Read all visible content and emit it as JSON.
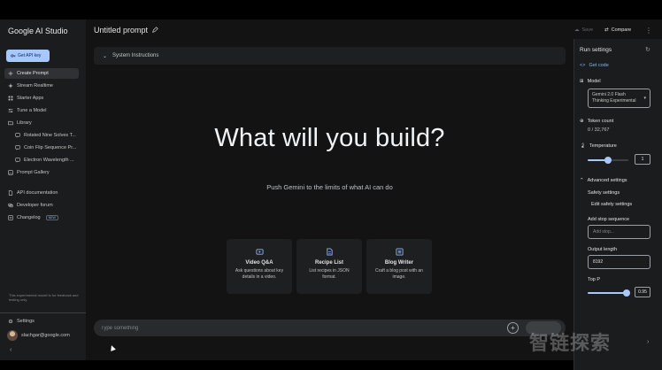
{
  "sidebar": {
    "brand": "Google AI Studio",
    "api_key_button": "Get API key",
    "items": [
      {
        "label": "Create Prompt",
        "icon": "plus-icon"
      },
      {
        "label": "Stream Realtime",
        "icon": "sparkle-icon"
      },
      {
        "label": "Starter Apps",
        "icon": "apps-icon"
      },
      {
        "label": "Tune a Model",
        "icon": "tune-icon"
      },
      {
        "label": "Library",
        "icon": "folder-icon"
      },
      {
        "label": "Rotated Nine Solves T...",
        "icon": "chat-icon"
      },
      {
        "label": "Coin Flip Sequence Pr...",
        "icon": "chat-icon"
      },
      {
        "label": "Electron Wavelength ...",
        "icon": "chat-icon"
      },
      {
        "label": "Prompt Gallery",
        "icon": "gallery-icon"
      },
      {
        "label": "API documentation",
        "icon": "doc-icon"
      },
      {
        "label": "Developer forum",
        "icon": "forum-icon"
      },
      {
        "label": "Changelog",
        "icon": "changelog-icon",
        "badge": "NEW"
      }
    ],
    "note": "This experimental model is for feedback and testing only.",
    "settings": "Settings",
    "user_email": "slachgar@google.com",
    "collapse": "‹"
  },
  "header": {
    "title": "Untitled prompt",
    "save": "Save",
    "compare": "Compare"
  },
  "main": {
    "system_instructions": "System Instructions",
    "hero": "What will you build?",
    "subtitle": "Push Gemini to the limits of what AI can do",
    "cards": [
      {
        "title": "Video Q&A",
        "desc": "Ask questions about key details in a video."
      },
      {
        "title": "Recipe List",
        "desc": "List recipes in JSON format."
      },
      {
        "title": "Blog Writer",
        "desc": "Craft a blog post with an image."
      }
    ],
    "input_placeholder": "Type something"
  },
  "run_settings": {
    "title": "Run settings",
    "get_code": "Get code",
    "model_label": "Model",
    "model_value_line1": "Gemini 2.0 Flash",
    "model_value_line2": "Thinking Experimental",
    "token_label": "Token count",
    "token_value": "0 / 32,767",
    "temperature_label": "Temperature",
    "temperature_value": "1",
    "temperature_fraction": 0.5,
    "advanced_label": "Advanced settings",
    "safety_label": "Safety settings",
    "edit_safety": "Edit safety settings",
    "stop_label": "Add stop sequence",
    "stop_placeholder": "Add stop...",
    "output_label": "Output length",
    "output_value": "8192",
    "topp_label": "Top P",
    "topp_value": "0.95",
    "topp_fraction": 0.95
  },
  "watermark": "智链探索",
  "colors": {
    "accent": "#a8c7fa",
    "link": "#8ab4f8",
    "bg": "#131314",
    "panel": "#1b1c1d"
  }
}
